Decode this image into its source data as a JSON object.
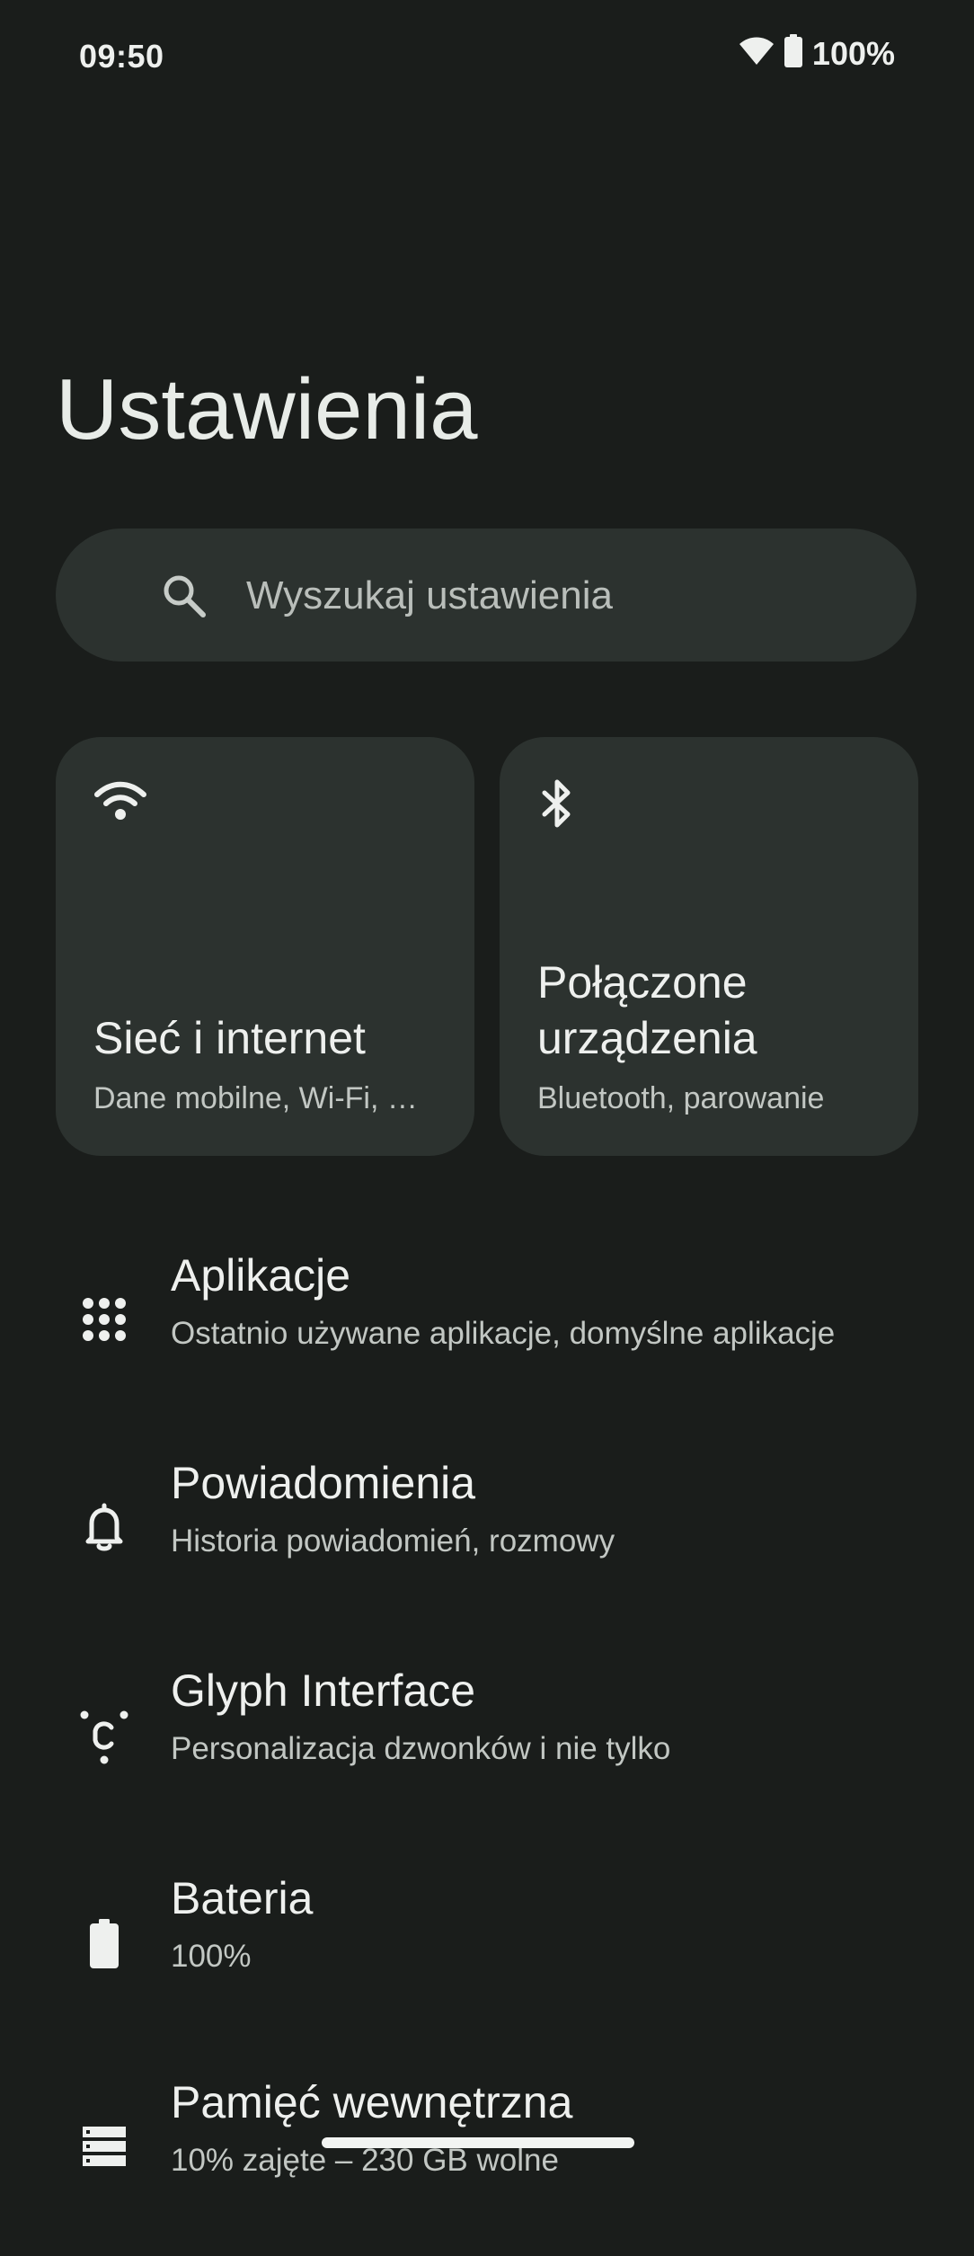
{
  "status_bar": {
    "time": "09:50",
    "battery_percent": "100%",
    "icons": [
      "wifi-icon",
      "battery-icon"
    ]
  },
  "page": {
    "title": "Ustawienia"
  },
  "search": {
    "placeholder": "Wyszukaj ustawienia",
    "icon": "search-icon"
  },
  "tiles": [
    {
      "icon": "wifi-icon",
      "title": "Sieć i internet",
      "subtitle": "Dane mobilne, Wi-Fi, …"
    },
    {
      "icon": "bluetooth-icon",
      "title": "Połączone urządzenia",
      "subtitle": "Bluetooth, parowanie"
    }
  ],
  "items": [
    {
      "icon": "apps-grid-icon",
      "title": "Aplikacje",
      "subtitle": "Ostatnio używane aplikacje, domyślne aplikacje"
    },
    {
      "icon": "bell-icon",
      "title": "Powiadomienia",
      "subtitle": "Historia powiadomień, rozmowy"
    },
    {
      "icon": "glyph-icon",
      "title": "Glyph Interface",
      "subtitle": "Personalizacja dzwonków i nie tylko"
    },
    {
      "icon": "battery-icon",
      "title": "Bateria",
      "subtitle": "100%"
    },
    {
      "icon": "storage-icon",
      "title": "Pamięć wewnętrzna",
      "subtitle": "10% zajęte – 230 GB wolne"
    }
  ],
  "colors": {
    "background": "#1a1d1b",
    "surface": "#2c322f",
    "text_primary": "#eef0ee",
    "text_secondary": "#c2c7c3"
  }
}
